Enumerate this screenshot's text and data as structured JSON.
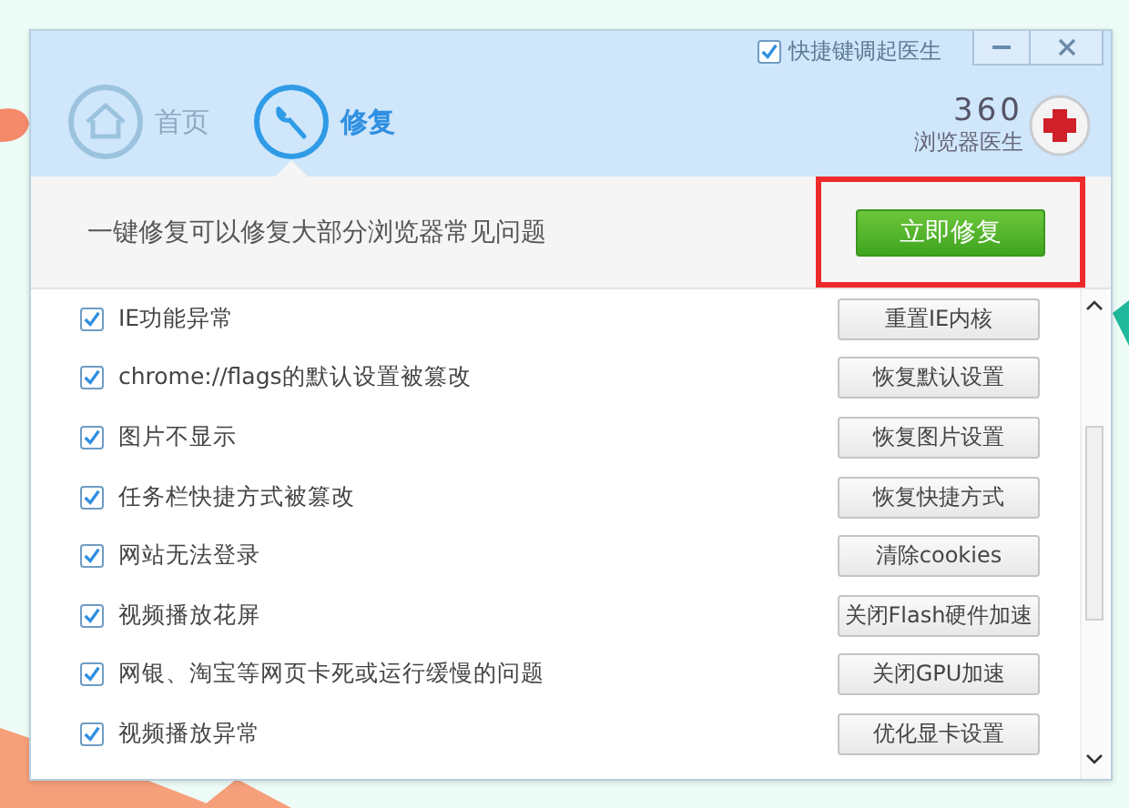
{
  "header": {
    "hotkey_option": {
      "label": "快捷键调起医生",
      "checked": true
    },
    "tabs": [
      {
        "label": "首页",
        "kind": "home",
        "selected": false
      },
      {
        "label": "修复",
        "kind": "repair",
        "selected": true
      }
    ],
    "brand": {
      "number": "360",
      "name": "浏览器医生"
    }
  },
  "banner": {
    "text": "一键修复可以修复大部分浏览器常见问题",
    "fix_button": {
      "label": "立即修复",
      "highlighted": true
    }
  },
  "issues": [
    {
      "label": "IE功能异常",
      "checked": true,
      "action": "重置IE内核"
    },
    {
      "label": "chrome://flags的默认设置被篡改",
      "checked": true,
      "action": "恢复默认设置"
    },
    {
      "label": "图片不显示",
      "checked": true,
      "action": "恢复图片设置"
    },
    {
      "label": "任务栏快捷方式被篡改",
      "checked": true,
      "action": "恢复快捷方式"
    },
    {
      "label": "网站无法登录",
      "checked": true,
      "action": "清除cookies"
    },
    {
      "label": "视频播放花屏",
      "checked": true,
      "action": "关闭Flash硬件加速"
    },
    {
      "label": "网银、淘宝等网页卡死或运行缓慢的问题",
      "checked": true,
      "action": "关闭GPU加速"
    },
    {
      "label": "视频播放异常",
      "checked": true,
      "action": "优化显卡设置"
    }
  ]
}
